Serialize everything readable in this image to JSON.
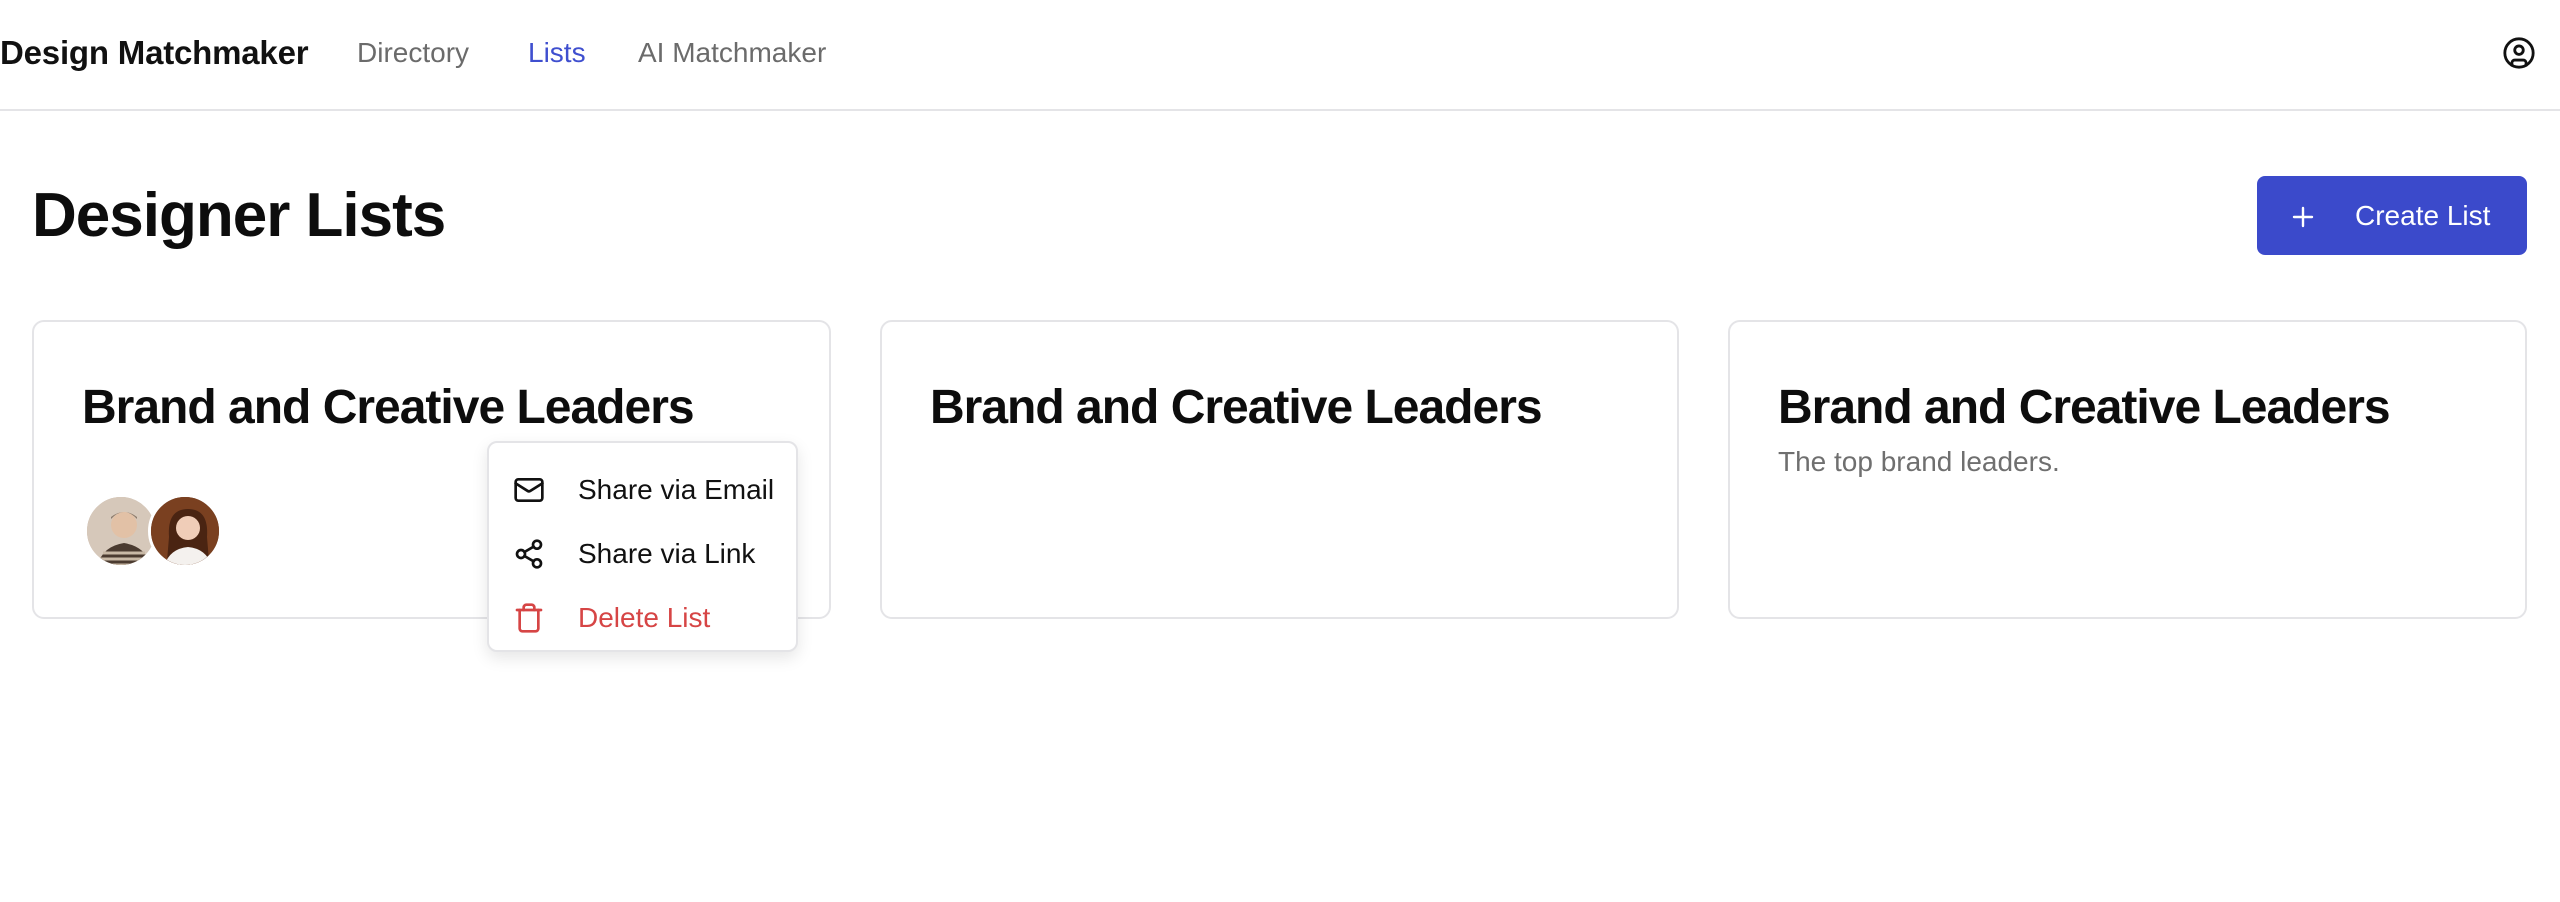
{
  "nav": {
    "brand": "Design Matchmaker",
    "links": [
      {
        "label": "Directory",
        "active": false
      },
      {
        "label": "Lists",
        "active": true
      },
      {
        "label": "AI Matchmaker",
        "active": false
      }
    ],
    "profile_icon": "user-circle-icon"
  },
  "page": {
    "title": "Designer Lists",
    "create_button": {
      "label": "Create List",
      "icon": "plus-icon"
    }
  },
  "lists": [
    {
      "title": "Brand and Creative Leaders",
      "description": "",
      "avatars": [
        "avatar-man",
        "avatar-woman"
      ]
    },
    {
      "title": "Brand and Creative Leaders",
      "description": "",
      "avatars": []
    },
    {
      "title": "Brand and Creative Leaders",
      "description": "The top brand leaders.",
      "avatars": []
    }
  ],
  "context_menu": {
    "items": [
      {
        "label": "Share via Email",
        "icon": "mail-icon"
      },
      {
        "label": "Share via Link",
        "icon": "share-icon"
      },
      {
        "label": "Delete List",
        "icon": "trash-icon",
        "danger": true
      }
    ]
  },
  "colors": {
    "accent": "#3b4acb",
    "active_link": "#3f4fcf",
    "danger": "#d64545",
    "border": "#e4e4e7",
    "muted_text": "#6f6f6f"
  }
}
